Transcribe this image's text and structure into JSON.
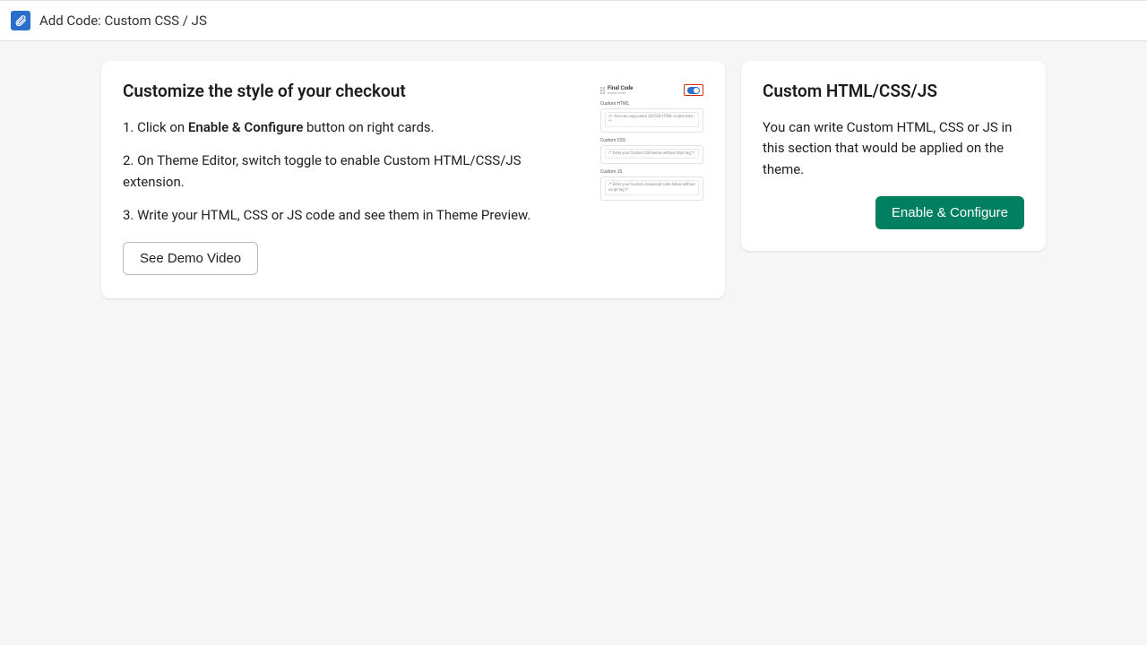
{
  "topbar": {
    "title": "Add Code: Custom CSS / JS"
  },
  "leftCard": {
    "title": "Customize the style of your checkout",
    "step1_prefix": "1. Click on ",
    "step1_bold": "Enable & Configure",
    "step1_suffix": " button on right cards.",
    "step2": "2. On Theme Editor, switch toggle to enable Custom HTML/CSS/JS extension.",
    "step3": "3. Write your HTML, CSS or JS code and see them in Theme Preview.",
    "demoButton": "See Demo Video"
  },
  "preview": {
    "title": "Final Code",
    "subtitle": "Insert code",
    "html_label": "Custom HTML",
    "html_text": "<!-- You can copy paste JS/CSS/HTML scripts here -->",
    "css_label": "Custom CSS",
    "css_text": "/* Enter your Custom CSS below without style tag */",
    "js_label": "Custom JS",
    "js_text": "/* Enter your Custom Javascript code below without script tag */"
  },
  "rightCard": {
    "title": "Custom HTML/CSS/JS",
    "desc": "You can write Custom HTML, CSS or JS in this section that would be applied on the theme.",
    "button": "Enable & Configure"
  }
}
